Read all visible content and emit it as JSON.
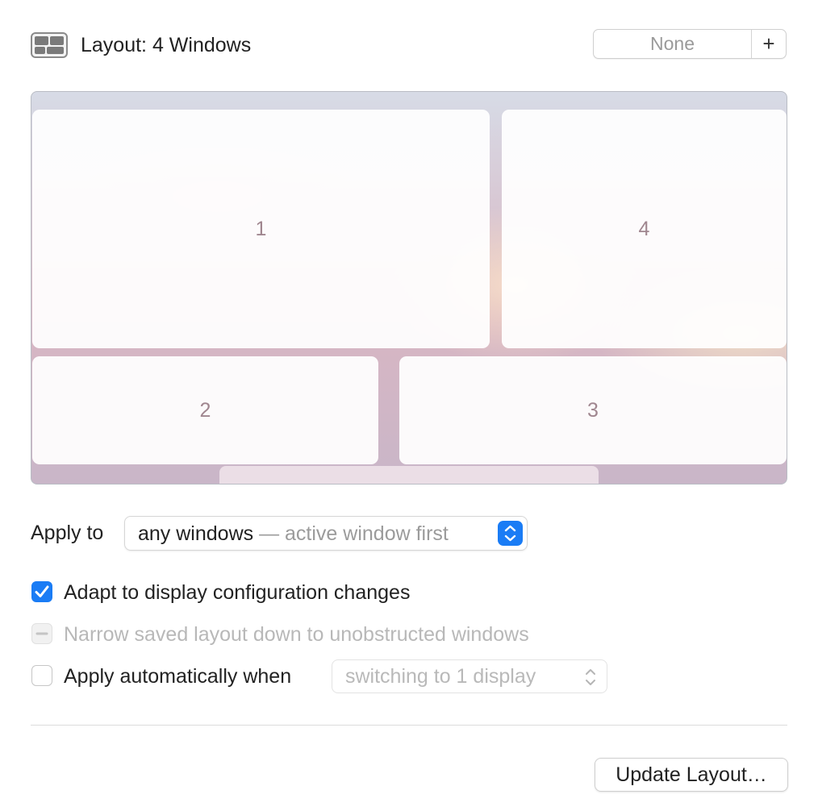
{
  "header": {
    "layout_icon": "grid-layout-icon",
    "title": "Layout: 4 Windows",
    "shortcut": {
      "value": "None",
      "add_label": "+"
    }
  },
  "preview": {
    "zones": [
      {
        "label": "1"
      },
      {
        "label": "4"
      },
      {
        "label": "2"
      },
      {
        "label": "3"
      }
    ]
  },
  "apply_to": {
    "label": "Apply to",
    "value_main": "any windows",
    "value_sub": " — active window first",
    "icon": "up-down-chevron-icon",
    "accent": "#1a7cf5"
  },
  "options": {
    "adapt": {
      "label": "Adapt to display configuration changes",
      "checked": true
    },
    "narrow": {
      "label": "Narrow saved layout down to unobstructed windows",
      "state": "mixed",
      "disabled": true
    },
    "auto_apply": {
      "label": "Apply automatically when",
      "checked": false,
      "select_value": "switching to 1 display"
    }
  },
  "footer": {
    "update_button": "Update Layout…"
  }
}
